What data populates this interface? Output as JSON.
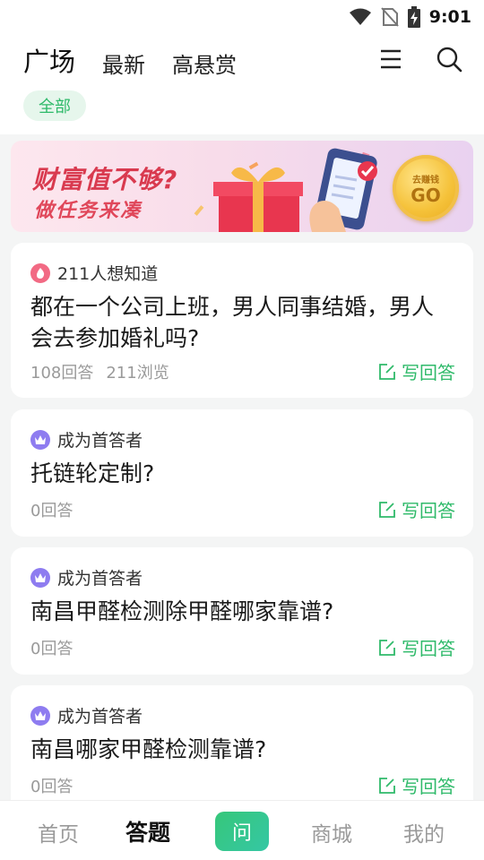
{
  "status_bar": {
    "time": "9:01",
    "icons": [
      "wifi-icon",
      "no-sim-icon",
      "battery-charging-icon"
    ]
  },
  "header": {
    "tabs": [
      {
        "label": "广场",
        "active": true
      },
      {
        "label": "最新",
        "active": false
      },
      {
        "label": "高悬赏",
        "active": false
      }
    ],
    "buttons": [
      "menu-icon",
      "search-icon"
    ]
  },
  "filter": {
    "chip_label": "全部"
  },
  "banner": {
    "line1": "财富值不够?",
    "line2": "做任务来凑",
    "coin_small": "去赚钱",
    "coin_go": "GO"
  },
  "questions": [
    {
      "badge_icon": "fire-icon",
      "meta": "211人想知道",
      "title": "都在一个公司上班，男人同事结婚，男人会去参加婚礼吗?",
      "answers": "108回答",
      "views": "211浏览",
      "answer_label": "写回答"
    },
    {
      "badge_icon": "crown-icon",
      "meta": "成为首答者",
      "title": "托链轮定制?",
      "answers": "0回答",
      "views": "",
      "answer_label": "写回答"
    },
    {
      "badge_icon": "crown-icon",
      "meta": "成为首答者",
      "title": "南昌甲醛检测除甲醛哪家靠谱?",
      "answers": "0回答",
      "views": "",
      "answer_label": "写回答"
    },
    {
      "badge_icon": "crown-icon",
      "meta": "成为首答者",
      "title": "南昌哪家甲醛检测靠谱?",
      "answers": "0回答",
      "views": "",
      "answer_label": "写回答"
    }
  ],
  "bottom_nav": {
    "items": [
      {
        "label": "首页",
        "active": false
      },
      {
        "label": "答题",
        "active": true
      },
      {
        "label": "问",
        "active": false
      },
      {
        "label": "商城",
        "active": false
      },
      {
        "label": "我的",
        "active": false
      }
    ]
  },
  "colors": {
    "accent_green": "#2fba6a",
    "chip_bg": "#e6f6ec",
    "fire_badge": "#f26a84",
    "crown_badge": "#8e7cf0",
    "banner_text": "#d93a4f"
  }
}
